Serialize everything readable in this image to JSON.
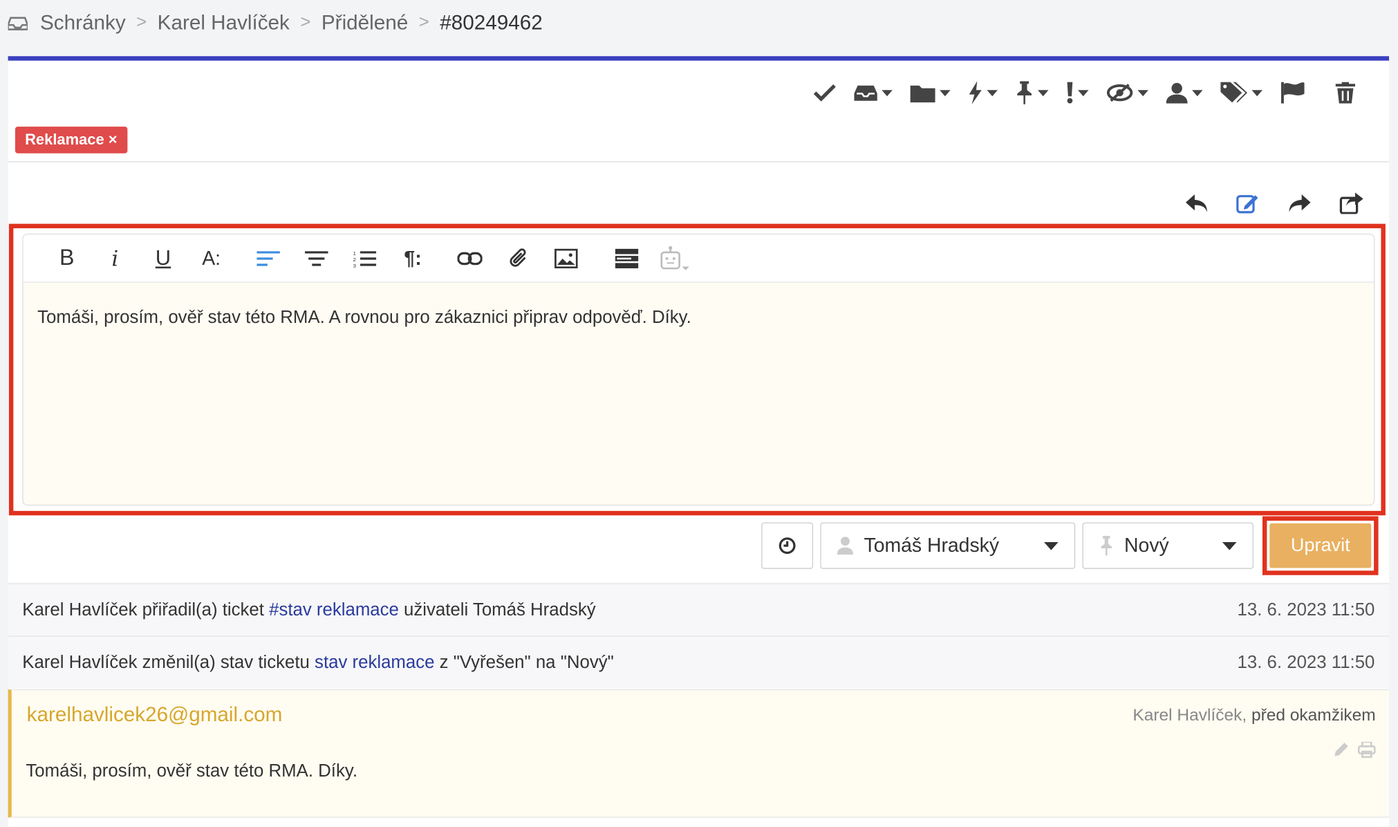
{
  "breadcrumb": {
    "icon": "inbox-icon",
    "items": [
      "Schránky",
      "Karel Havlíček",
      "Přidělené",
      "#80249462"
    ],
    "separator": ">"
  },
  "toolbar": {
    "icons": [
      "check-icon",
      "inbox-icon",
      "folder-icon",
      "bolt-icon",
      "pin-icon",
      "exclamation-icon",
      "eye-slash-icon",
      "user-icon",
      "tags-icon",
      "flag-icon",
      "trash-icon"
    ]
  },
  "tag": {
    "label": "Reklamace ×",
    "color": "#e04b4b"
  },
  "reply_actions": [
    "reply-icon",
    "edit-note-icon",
    "forward-icon",
    "share-icon"
  ],
  "editor": {
    "toolbar": [
      "bold",
      "italic",
      "underline",
      "font-size",
      "align-left",
      "align-center",
      "numbered-list",
      "paragraph",
      "link",
      "attachment",
      "image",
      "template",
      "bot"
    ],
    "bold_label": "B",
    "italic_label": "i",
    "underline_label": "U",
    "font_label": "A:",
    "paragraph_label": "¶:",
    "text": "Tomáši, prosím, ověř stav této RMA. A rovnou pro zákaznici připrav odpověď. Díky."
  },
  "controls": {
    "assignee": "Tomáš Hradský",
    "status": "Nový",
    "save_label": "Upravit"
  },
  "events": [
    {
      "text_before": "Karel Havlíček přiřadil(a) ticket ",
      "link": "#stav reklamace",
      "text_after": " uživateli Tomáš Hradský",
      "time": "13. 6. 2023 11:50"
    },
    {
      "text_before": "Karel Havlíček změnil(a) stav ticketu ",
      "link": "stav reklamace",
      "text_after": " z \"Vyřešen\" na \"Nový\"",
      "time": "13. 6. 2023 11:50"
    }
  ],
  "message": {
    "from": "karelhavlicek26@gmail.com",
    "author": "Karel Havlíček,",
    "relative_time": "před okamžikem",
    "body": "Tomáši, prosím, ověř stav této RMA. Díky."
  },
  "colors": {
    "accent_bar": "#3a3fbf",
    "highlight": "#e0321f",
    "save_button": "#e8b060",
    "link": "#2a3b9c",
    "note_border": "#e6b84a"
  }
}
